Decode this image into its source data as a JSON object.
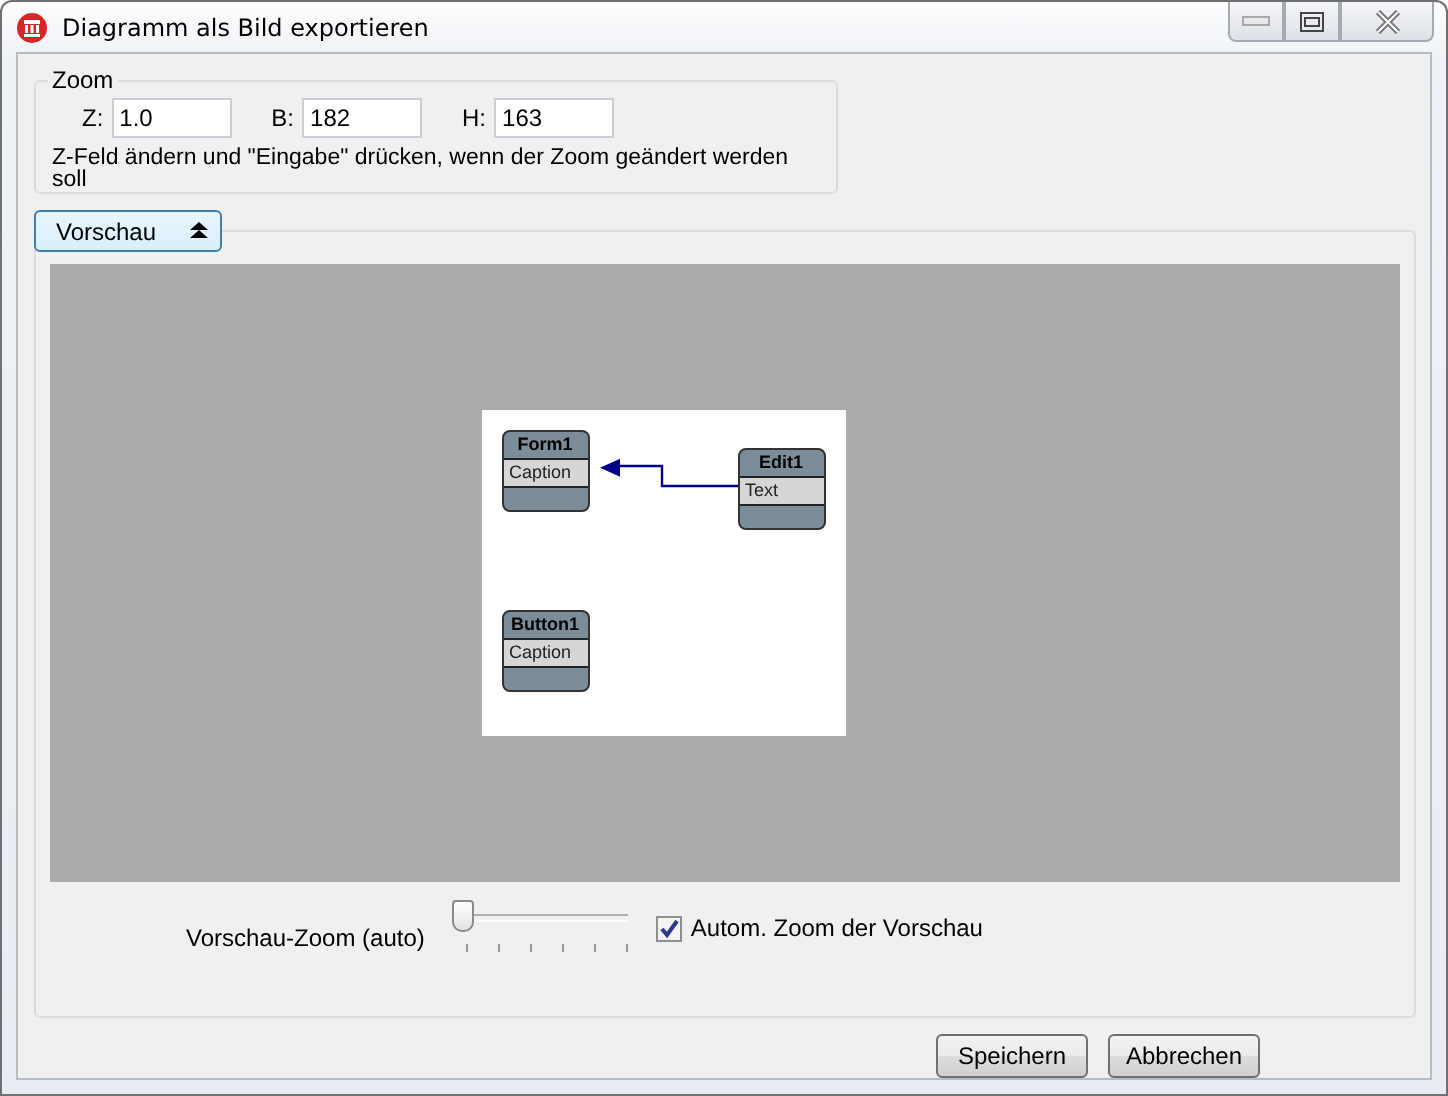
{
  "window": {
    "title": "Diagramm als Bild exportieren"
  },
  "zoom_group": {
    "title": "Zoom",
    "fields": [
      {
        "label": "Z:",
        "value": "1.0"
      },
      {
        "label": "B:",
        "value": "182"
      },
      {
        "label": "H:",
        "value": "163"
      }
    ],
    "hint": "Z-Feld ändern und \"Eingabe\" drücken, wenn der Zoom geändert werden soll"
  },
  "preview": {
    "toggle_label": "Vorschau",
    "expanded": true,
    "nodes": [
      {
        "title": "Form1",
        "field": "Caption"
      },
      {
        "title": "Edit1",
        "field": "Text"
      },
      {
        "title": "Button1",
        "field": "Caption"
      }
    ],
    "slider": {
      "label": "Vorschau-Zoom (auto)",
      "level": 0
    },
    "checkbox": {
      "label": "Autom. Zoom der Vorschau",
      "checked": true
    }
  },
  "buttons": [
    "Speichern",
    "Abbrechen"
  ]
}
